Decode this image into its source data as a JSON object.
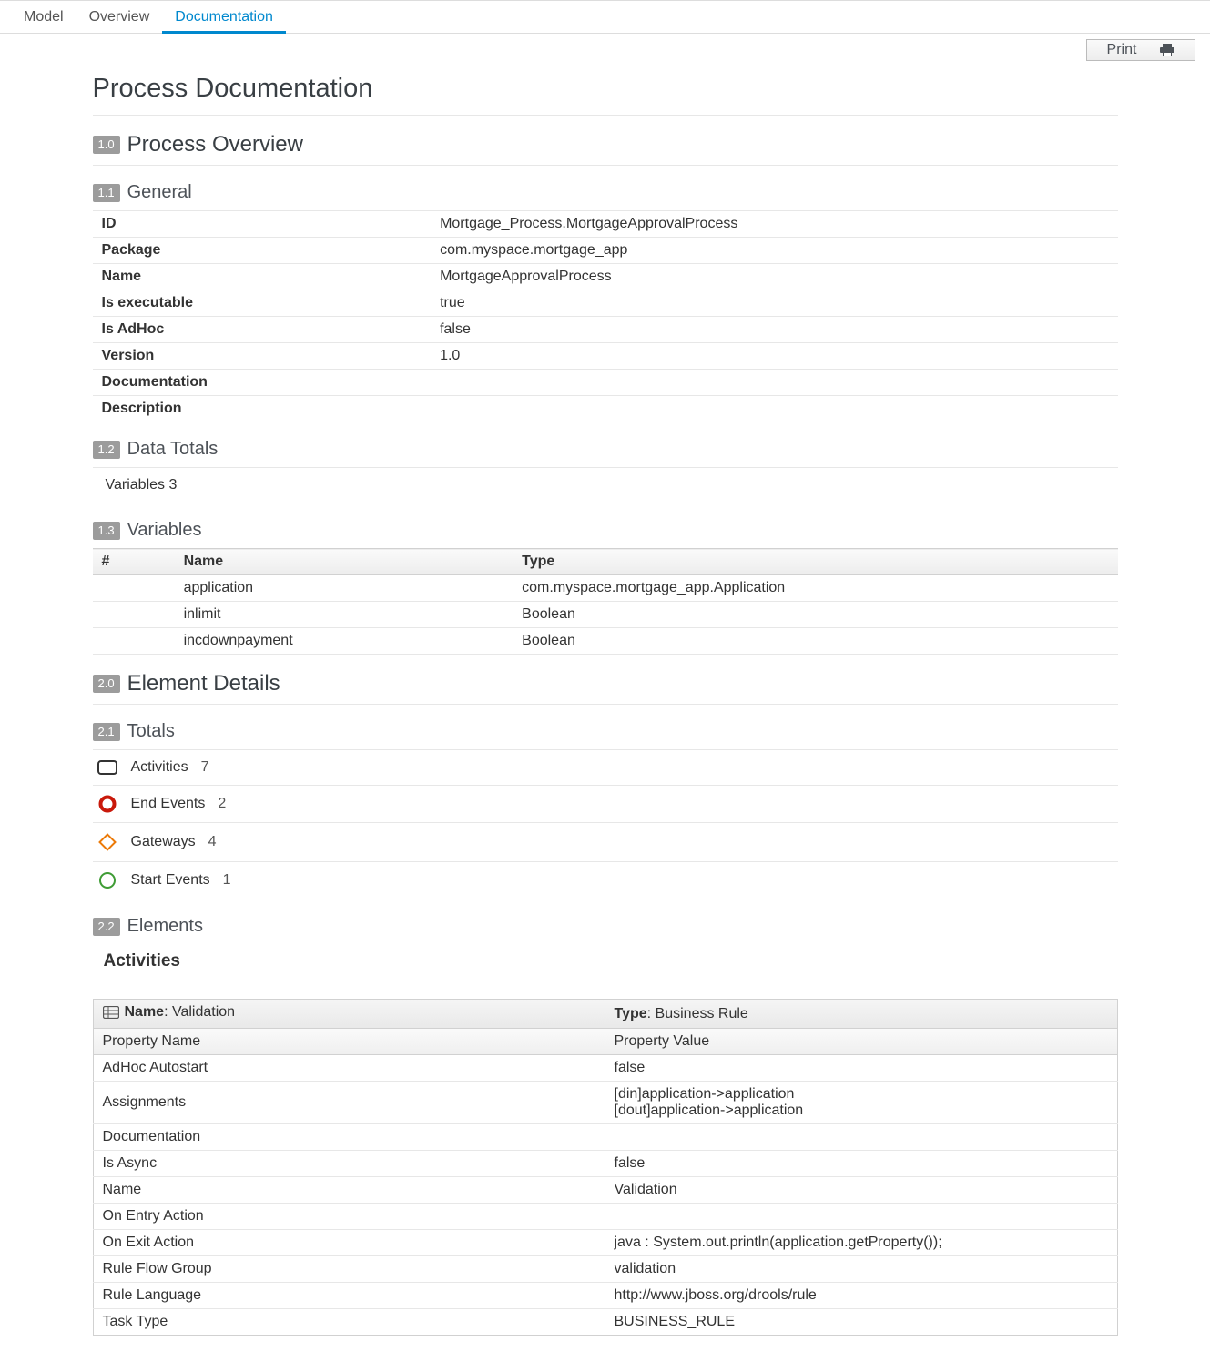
{
  "tabs": {
    "model": "Model",
    "overview": "Overview",
    "documentation": "Documentation"
  },
  "print_label": "Print",
  "page_title": "Process Documentation",
  "sections": {
    "process_overview": {
      "num": "1.0",
      "title": "Process Overview"
    },
    "general": {
      "num": "1.1",
      "title": "General"
    },
    "data_totals": {
      "num": "1.2",
      "title": "Data Totals"
    },
    "variables": {
      "num": "1.3",
      "title": "Variables"
    },
    "element_details": {
      "num": "2.0",
      "title": "Element Details"
    },
    "totals": {
      "num": "2.1",
      "title": "Totals"
    },
    "elements": {
      "num": "2.2",
      "title": "Elements"
    }
  },
  "general": [
    {
      "k": "ID",
      "v": "Mortgage_Process.MortgageApprovalProcess"
    },
    {
      "k": "Package",
      "v": "com.myspace.mortgage_app"
    },
    {
      "k": "Name",
      "v": "MortgageApprovalProcess"
    },
    {
      "k": "Is executable",
      "v": "true"
    },
    {
      "k": "Is AdHoc",
      "v": "false"
    },
    {
      "k": "Version",
      "v": "1.0"
    },
    {
      "k": "Documentation",
      "v": ""
    },
    {
      "k": "Description",
      "v": ""
    }
  ],
  "data_totals_line": "Variables 3",
  "var_headers": {
    "num": "#",
    "name": "Name",
    "type": "Type"
  },
  "variables": [
    {
      "num": "",
      "name": "application",
      "type": "com.myspace.mortgage_app.Application"
    },
    {
      "num": "",
      "name": "inlimit",
      "type": "Boolean"
    },
    {
      "num": "",
      "name": "incdownpayment",
      "type": "Boolean"
    }
  ],
  "totals": [
    {
      "icon": "activity",
      "label": "Activities",
      "count": "7"
    },
    {
      "icon": "endevent",
      "label": "End Events",
      "count": "2"
    },
    {
      "icon": "gateway",
      "label": "Gateways",
      "count": "4"
    },
    {
      "icon": "startevent",
      "label": "Start Events",
      "count": "1"
    }
  ],
  "activities_heading": "Activities",
  "el_labels": {
    "name": "Name",
    "type": "Type",
    "propname": "Property Name",
    "propval": "Property Value"
  },
  "element": {
    "name": "Validation",
    "type": "Business Rule",
    "props": [
      {
        "k": "AdHoc Autostart",
        "v": "false"
      },
      {
        "k": "Assignments",
        "v": "[din]application->application\n[dout]application->application"
      },
      {
        "k": "Documentation",
        "v": ""
      },
      {
        "k": "Is Async",
        "v": "false"
      },
      {
        "k": "Name",
        "v": "Validation"
      },
      {
        "k": "On Entry Action",
        "v": ""
      },
      {
        "k": "On Exit Action",
        "v": "java : System.out.println(application.getProperty());"
      },
      {
        "k": "Rule Flow Group",
        "v": "validation"
      },
      {
        "k": "Rule Language",
        "v": "http://www.jboss.org/drools/rule"
      },
      {
        "k": "Task Type",
        "v": "BUSINESS_RULE"
      }
    ]
  }
}
